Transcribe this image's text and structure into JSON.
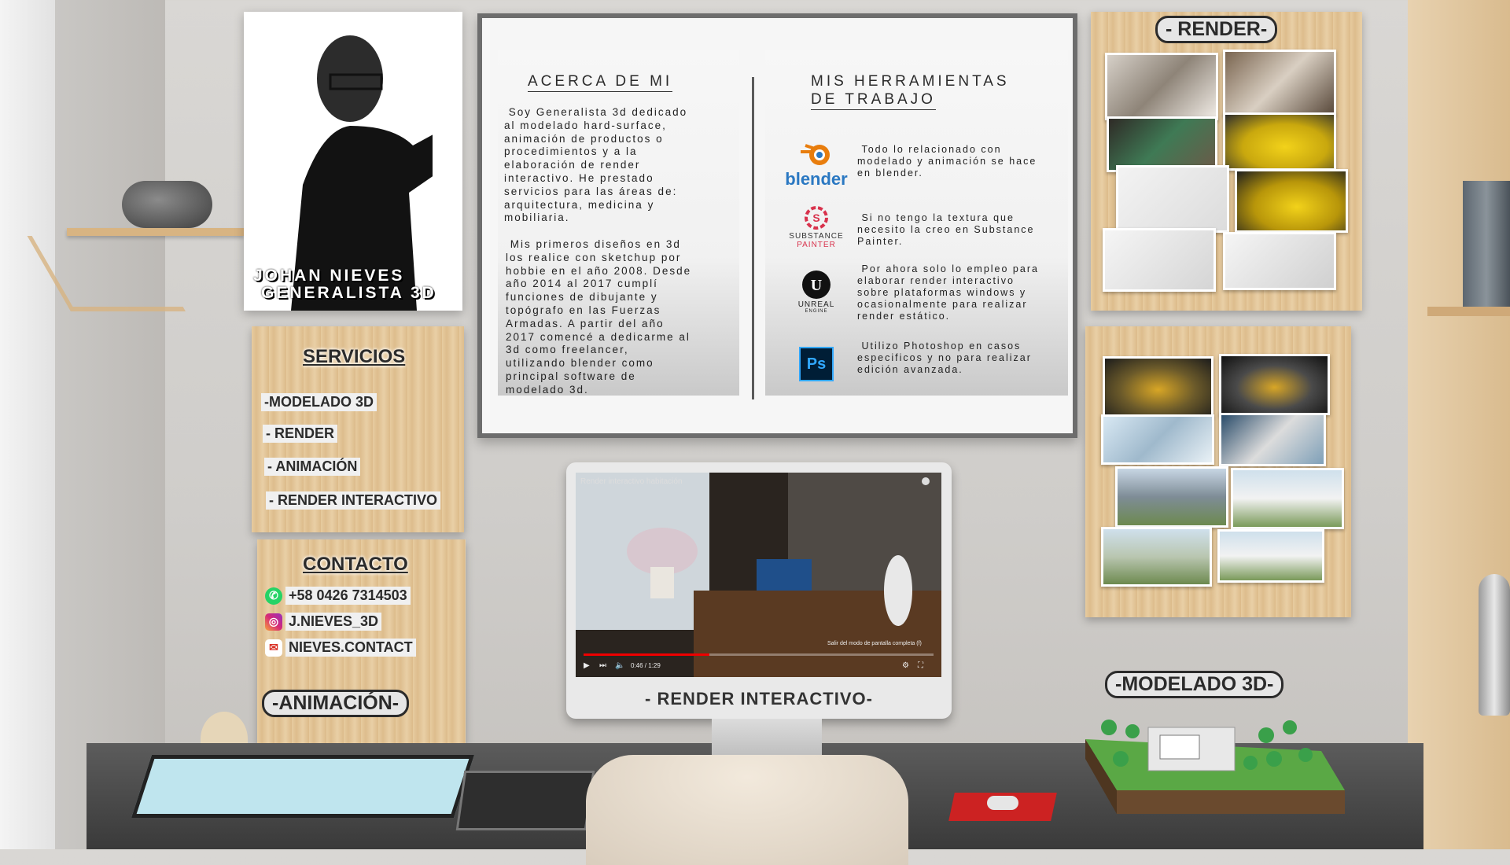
{
  "portrait": {
    "name_line1": "JOHAN NIEVES",
    "name_line2": "GENERALISTA 3D"
  },
  "about": {
    "title": "ACERCA DE MI",
    "paragraph1": " Soy Generalista 3d dedicado\nal modelado hard-surface,\nanimación de productos o\nprocedimientos y a la\nelaboración de render\ninteractivo. He prestado\nservicios para las áreas de:\narquitectura, medicina y\nmobiliaria.",
    "paragraph2": " Mis primeros diseños en 3d\nlos realice con sketchup por\nhobbie en el año 2008. Desde\naño 2014 al 2017 cumplí\nfunciones de dibujante y\ntopógrafo en las Fuerzas\nArmadas. A partir del año\n2017 comencé a dedicarme al\n3d como freelancer,\nutilizando blender como\nprincipal software de\nmodelado 3d."
  },
  "tools": {
    "title_line1": "MIS HERRAMIENTAS",
    "title_line2": "DE TRABAJO",
    "items": [
      {
        "icon": "blender-icon",
        "logo_text": "blender",
        "color": "#2a78c2",
        "accent": "#e87d0d",
        "text": " Todo lo relacionado con\nmodelado y animación se hace\nen blender."
      },
      {
        "icon": "substance-painter-icon",
        "logo_text": "SUBSTANCE",
        "logo_sub": "PAINTER",
        "color": "#d8324c",
        "text": " Si no tengo la textura que\nnecesito la creo en Substance\nPainter."
      },
      {
        "icon": "unreal-engine-icon",
        "logo_text": "UNREAL",
        "logo_sub": "ENGINE",
        "color": "#111111",
        "text": " Por ahora solo lo empleo para\nelaborar render interactivo\nsobre plataformas windows y\nocasionalmente para realizar\nrender estático."
      },
      {
        "icon": "photoshop-icon",
        "logo_text": "Ps",
        "color": "#31a8ff",
        "bg": "#001e36",
        "text": " Utilizo Photoshop en casos\nespecificos y no para realizar\nedición avanzada."
      }
    ]
  },
  "servicios": {
    "title": "SERVICIOS",
    "items": [
      "-MODELADO 3D",
      "- RENDER",
      "- ANIMACIÓN",
      "- RENDER INTERACTIVO"
    ]
  },
  "contacto": {
    "title": "CONTACTO",
    "phone": "+58 0426 7314503",
    "instagram": "J.NIEVES_3D",
    "email": "NIEVES.CONTACT"
  },
  "tags": {
    "render": "- RENDER-",
    "animacion": "-ANIMACIÓN-",
    "modelado": "-MODELADO 3D-"
  },
  "monitor": {
    "video_title": "Render interactivo habitación",
    "time": "0:46 / 1:29",
    "fullscreen_hint": "Salir del modo de pantalla completa (f)",
    "label": "- RENDER INTERACTIVO-",
    "progress": 0.36
  }
}
